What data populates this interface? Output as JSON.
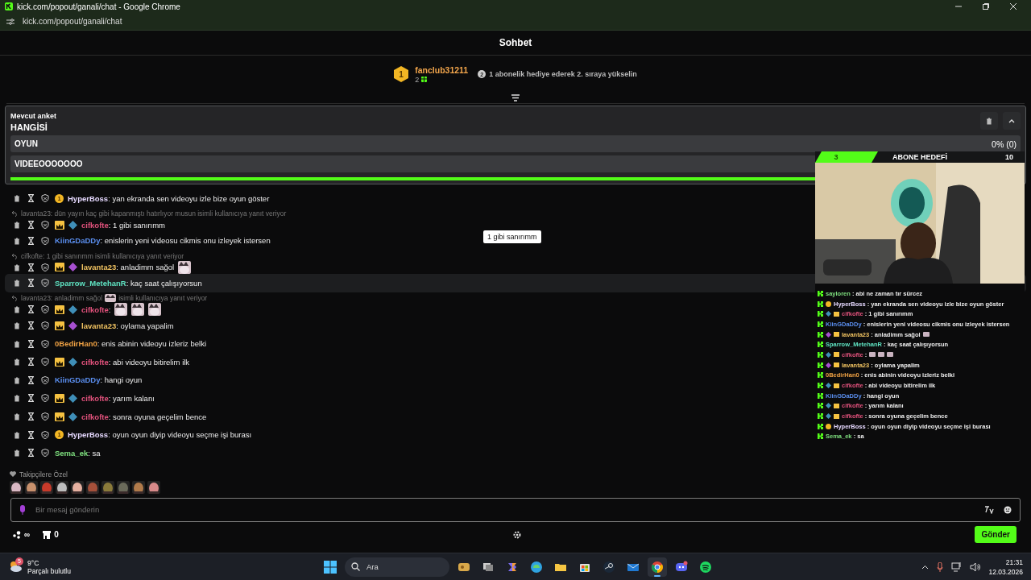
{
  "window": {
    "title": "kick.com/popout/ganali/chat - Google Chrome",
    "address": "kick.com/popout/ganali/chat"
  },
  "header": {
    "title": "Sohbet"
  },
  "leaderboard": {
    "rank": "1",
    "user": "fanclub31211",
    "count": "2",
    "hint_rank": "2",
    "hint": "1 abonelik hediye ederek 2. sıraya yükselin"
  },
  "poll": {
    "label": "Mevcut anket",
    "question": "HANGİSİ",
    "options": [
      {
        "label": "OYUN",
        "result": "0% (0)",
        "level": 0
      },
      {
        "label": "VIDEEOOOOOOO",
        "level": 0
      }
    ],
    "timer": {
      "level": 1
    }
  },
  "messages": [
    {
      "user": "HyperBoss",
      "color": "#e6d9ff",
      "text": ": yan ekranda sen videoyu izle bize oyun göster",
      "badges": [
        {
          "kind": "rank",
          "text": "1"
        }
      ],
      "highlighted": false
    },
    {
      "reply": {
        "text": "lavanta23: dün yayın kaç gibi kapanmıştı hatırlıyor musun isimli kullanıcıya yanıt veriyor"
      },
      "user": "cifkofte",
      "color": "#e2527c",
      "text": ": 1 gibi sanırımm",
      "badges": [
        {
          "kind": "crown"
        },
        {
          "kind": "gem",
          "color": "#3f8fb8"
        }
      ],
      "highlighted": false
    },
    {
      "user": "KiinGDaDDy",
      "color": "#5b8ff0",
      "text": ": enislerin yeni videosu cikmis onu izleyek istersen",
      "highlighted": false
    },
    {
      "reply": {
        "text": "cifkofte: 1 gibi sanırımm isimli kullanıcıya yanıt veriyor"
      },
      "user": "lavanta23",
      "color": "#f2c462",
      "text": ": anladimm sağol",
      "emotes": [
        {
          "kind": "picture"
        }
      ],
      "badges": [
        {
          "kind": "crown"
        },
        {
          "kind": "gem",
          "color": "#a64fd0"
        }
      ],
      "highlighted": false
    },
    {
      "user": "Sparrow_MetehanR",
      "color": "#5fe3c2",
      "text": ": kaç saat çalışıyorsun",
      "highlighted": true
    },
    {
      "reply": {
        "text": "lavanta23: anladimm sağol",
        "emote": true,
        "suffix": "isimli kullanıcıya yanıt veriyor"
      },
      "user": "cifkofte",
      "color": "#e2527c",
      "text": ":",
      "emotes": [
        {
          "kind": "picture"
        },
        {
          "kind": "picture"
        },
        {
          "kind": "picture"
        }
      ],
      "badges": [
        {
          "kind": "crown"
        },
        {
          "kind": "gem",
          "color": "#3f8fb8"
        }
      ],
      "highlighted": false
    },
    {
      "user": "lavanta23",
      "color": "#f2c462",
      "text": ": oylama yapalim",
      "badges": [
        {
          "kind": "crown"
        },
        {
          "kind": "gem",
          "color": "#a64fd0"
        }
      ],
      "highlighted": false
    },
    {
      "user": "0BedirHan0",
      "color": "#f0a244",
      "text": ": enis abinin videoyu izleriz belki",
      "highlighted": false
    },
    {
      "user": "cifkofte",
      "color": "#e2527c",
      "text": ": abi videoyu bitirelim ilk",
      "badges": [
        {
          "kind": "crown"
        },
        {
          "kind": "gem",
          "color": "#3f8fb8"
        }
      ],
      "highlighted": false
    },
    {
      "user": "KiinGDaDDy",
      "color": "#5b8ff0",
      "text": ": hangi oyun",
      "highlighted": false
    },
    {
      "user": "cifkofte",
      "color": "#e2527c",
      "text": ": yarım kalanı",
      "badges": [
        {
          "kind": "crown"
        },
        {
          "kind": "gem",
          "color": "#3f8fb8"
        }
      ],
      "highlighted": false
    },
    {
      "user": "cifkofte",
      "color": "#e2527c",
      "text": ": sonra oyuna geçelim bence",
      "badges": [
        {
          "kind": "crown"
        },
        {
          "kind": "gem",
          "color": "#3f8fb8"
        }
      ],
      "highlighted": false
    },
    {
      "user": "HyperBoss",
      "color": "#e6d9ff",
      "text": ": oyun oyun diyip videoyu seçme işi burası",
      "badges": [
        {
          "kind": "rank",
          "text": "1"
        }
      ],
      "highlighted": false
    },
    {
      "user": "Sema_ek",
      "color": "#7fe07f",
      "text": ": sa",
      "highlighted": false
    }
  ],
  "tooltip": {
    "text": "1 gibi sanırımm"
  },
  "followers_emotes": {
    "label": "Takipçilere Özel",
    "emotes": [
      {
        "kind": "picture"
      },
      {
        "kind": "picture"
      },
      {
        "kind": "picture"
      },
      {
        "kind": "picture"
      },
      {
        "kind": "picture"
      },
      {
        "kind": "picture"
      },
      {
        "kind": "picture"
      },
      {
        "kind": "picture"
      },
      {
        "kind": "picture"
      },
      {
        "kind": "picture"
      }
    ]
  },
  "composer": {
    "placeholder": "Bir mesaj gönderin",
    "send": "Gönder"
  },
  "footer": {
    "points": "∞",
    "store": "0"
  },
  "overlay": {
    "goal": {
      "label": "ABONE HEDEFİ",
      "current": "3",
      "target": "10",
      "level": 0.3
    },
    "chat": [
      {
        "user": "sayloren",
        "color": "#7fe07f",
        "text": ": abi ne zaman tır sürcez"
      },
      {
        "user": "HyperBoss",
        "color": "#e6d9ff",
        "text": ": yan ekranda sen videoyu izle bize oyun göster",
        "badges": [
          {
            "kind": "rank"
          }
        ]
      },
      {
        "user": "cifkofte",
        "color": "#e2527c",
        "text": ": 1 gibi sanırımm",
        "badges": [
          {
            "kind": "gem",
            "color": "#3f8fb8"
          },
          {
            "kind": "crown"
          }
        ]
      },
      {
        "user": "KiinGDaDDy",
        "color": "#5b8ff0",
        "text": ": enislerin yeni videosu cikmis onu izleyek istersen"
      },
      {
        "user": "lavanta23",
        "color": "#f2c462",
        "text": ": anladimm sağol",
        "emotes": [
          {
            "kind": "picture"
          }
        ],
        "badges": [
          {
            "kind": "gem",
            "color": "#a64fd0"
          },
          {
            "kind": "crown"
          }
        ]
      },
      {
        "user": "Sparrow_MetehanR",
        "color": "#5fe3c2",
        "text": ": kaç saat çalışıyorsun"
      },
      {
        "user": "cifkofte",
        "color": "#e2527c",
        "text": ":",
        "emotes": [
          {
            "kind": "picture"
          },
          {
            "kind": "picture"
          },
          {
            "kind": "picture"
          }
        ],
        "badges": [
          {
            "kind": "gem",
            "color": "#3f8fb8"
          },
          {
            "kind": "crown"
          }
        ]
      },
      {
        "user": "lavanta23",
        "color": "#f2c462",
        "text": ": oylama yapalim",
        "badges": [
          {
            "kind": "gem",
            "color": "#a64fd0"
          },
          {
            "kind": "crown"
          }
        ]
      },
      {
        "user": "0BedirHan0",
        "color": "#f0a244",
        "text": ": enis abinin videoyu izleriz belki"
      },
      {
        "user": "cifkofte",
        "color": "#e2527c",
        "text": ": abi videoyu bitirelim ilk",
        "badges": [
          {
            "kind": "gem",
            "color": "#3f8fb8"
          },
          {
            "kind": "crown"
          }
        ]
      },
      {
        "user": "KiinGDaDDy",
        "color": "#5b8ff0",
        "text": ": hangi oyun"
      },
      {
        "user": "cifkofte",
        "color": "#e2527c",
        "text": ": yarım kalanı",
        "badges": [
          {
            "kind": "gem",
            "color": "#3f8fb8"
          },
          {
            "kind": "crown"
          }
        ]
      },
      {
        "user": "cifkofte",
        "color": "#e2527c",
        "text": ": sonra oyuna geçelim bence",
        "badges": [
          {
            "kind": "gem",
            "color": "#3f8fb8"
          },
          {
            "kind": "crown"
          }
        ]
      },
      {
        "user": "HyperBoss",
        "color": "#e6d9ff",
        "text": ": oyun oyun diyip videoyu seçme işi burası",
        "badges": [
          {
            "kind": "rank"
          }
        ]
      },
      {
        "user": "Sema_ek",
        "color": "#7fe07f",
        "text": ": sa"
      }
    ]
  },
  "taskbar": {
    "weather": {
      "badge": "5",
      "temp": "9°C",
      "desc": "Parçalı bulutlu"
    },
    "search": "Ara",
    "apps": [
      {
        "kind": "widgets",
        "selected": false
      },
      {
        "kind": "taskview",
        "selected": false
      },
      {
        "kind": "copilot",
        "selected": false
      },
      {
        "kind": "edge",
        "selected": false
      },
      {
        "kind": "files",
        "selected": false
      },
      {
        "kind": "store",
        "selected": false
      },
      {
        "kind": "steam",
        "selected": false
      },
      {
        "kind": "mail",
        "selected": false
      },
      {
        "kind": "chrome",
        "selected": true
      },
      {
        "kind": "discord",
        "selected": false
      },
      {
        "kind": "spotify",
        "selected": false
      }
    ],
    "time": "21:31",
    "date": "12.03.2026"
  }
}
